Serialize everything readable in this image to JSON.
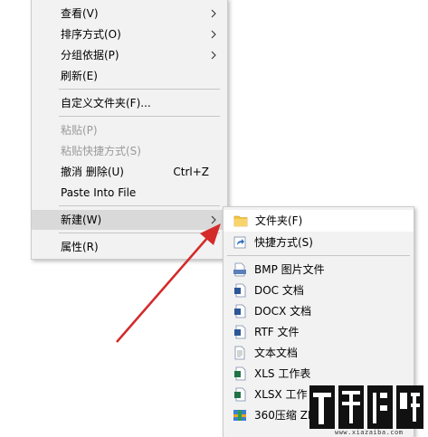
{
  "context_menu": {
    "items": [
      {
        "label": "查看(V)",
        "submenu": true
      },
      {
        "label": "排序方式(O)",
        "submenu": true
      },
      {
        "label": "分组依据(P)",
        "submenu": true
      },
      {
        "label": "刷新(E)"
      },
      {
        "label": "自定义文件夹(F)..."
      },
      {
        "label": "粘贴(P)",
        "disabled": true
      },
      {
        "label": "粘贴快捷方式(S)",
        "disabled": true
      },
      {
        "label": "撤消 删除(U)",
        "shortcut": "Ctrl+Z"
      },
      {
        "label": "Paste Into File"
      },
      {
        "label": "新建(W)",
        "submenu": true,
        "highlighted": true
      },
      {
        "label": "属性(R)"
      }
    ]
  },
  "new_submenu": {
    "items": [
      {
        "label": "文件夹(F)",
        "icon": "folder-icon"
      },
      {
        "label": "快捷方式(S)",
        "icon": "shortcut-icon"
      },
      {
        "label": "BMP 图片文件",
        "icon": "bmp-file-icon"
      },
      {
        "label": "DOC 文档",
        "icon": "doc-file-icon"
      },
      {
        "label": "DOCX 文档",
        "icon": "docx-file-icon"
      },
      {
        "label": "RTF 文件",
        "icon": "rtf-file-icon"
      },
      {
        "label": "文本文档",
        "icon": "text-file-icon"
      },
      {
        "label": "XLS 工作表",
        "icon": "xls-file-icon"
      },
      {
        "label": "XLSX 工作",
        "icon": "xlsx-file-icon"
      },
      {
        "label": "360压缩 ZI",
        "icon": "zip-archive-icon"
      }
    ]
  },
  "watermark": {
    "url": "www.xiazaiba.com"
  },
  "colors": {
    "arrow": "#d42a2a",
    "menu_bg": "#f2f2f2",
    "highlight": "#d9d9d9"
  }
}
